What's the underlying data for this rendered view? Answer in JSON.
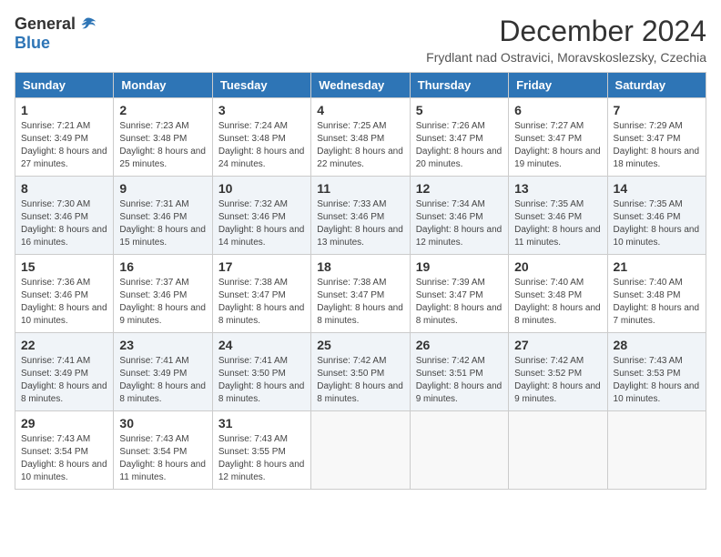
{
  "logo": {
    "general": "General",
    "blue": "Blue"
  },
  "title": "December 2024",
  "subtitle": "Frydlant nad Ostravici, Moravskoslezsky, Czechia",
  "days_of_week": [
    "Sunday",
    "Monday",
    "Tuesday",
    "Wednesday",
    "Thursday",
    "Friday",
    "Saturday"
  ],
  "weeks": [
    [
      {
        "day": "1",
        "info": "Sunrise: 7:21 AM\nSunset: 3:49 PM\nDaylight: 8 hours and 27 minutes."
      },
      {
        "day": "2",
        "info": "Sunrise: 7:23 AM\nSunset: 3:48 PM\nDaylight: 8 hours and 25 minutes."
      },
      {
        "day": "3",
        "info": "Sunrise: 7:24 AM\nSunset: 3:48 PM\nDaylight: 8 hours and 24 minutes."
      },
      {
        "day": "4",
        "info": "Sunrise: 7:25 AM\nSunset: 3:48 PM\nDaylight: 8 hours and 22 minutes."
      },
      {
        "day": "5",
        "info": "Sunrise: 7:26 AM\nSunset: 3:47 PM\nDaylight: 8 hours and 20 minutes."
      },
      {
        "day": "6",
        "info": "Sunrise: 7:27 AM\nSunset: 3:47 PM\nDaylight: 8 hours and 19 minutes."
      },
      {
        "day": "7",
        "info": "Sunrise: 7:29 AM\nSunset: 3:47 PM\nDaylight: 8 hours and 18 minutes."
      }
    ],
    [
      {
        "day": "8",
        "info": "Sunrise: 7:30 AM\nSunset: 3:46 PM\nDaylight: 8 hours and 16 minutes."
      },
      {
        "day": "9",
        "info": "Sunrise: 7:31 AM\nSunset: 3:46 PM\nDaylight: 8 hours and 15 minutes."
      },
      {
        "day": "10",
        "info": "Sunrise: 7:32 AM\nSunset: 3:46 PM\nDaylight: 8 hours and 14 minutes."
      },
      {
        "day": "11",
        "info": "Sunrise: 7:33 AM\nSunset: 3:46 PM\nDaylight: 8 hours and 13 minutes."
      },
      {
        "day": "12",
        "info": "Sunrise: 7:34 AM\nSunset: 3:46 PM\nDaylight: 8 hours and 12 minutes."
      },
      {
        "day": "13",
        "info": "Sunrise: 7:35 AM\nSunset: 3:46 PM\nDaylight: 8 hours and 11 minutes."
      },
      {
        "day": "14",
        "info": "Sunrise: 7:35 AM\nSunset: 3:46 PM\nDaylight: 8 hours and 10 minutes."
      }
    ],
    [
      {
        "day": "15",
        "info": "Sunrise: 7:36 AM\nSunset: 3:46 PM\nDaylight: 8 hours and 10 minutes."
      },
      {
        "day": "16",
        "info": "Sunrise: 7:37 AM\nSunset: 3:46 PM\nDaylight: 8 hours and 9 minutes."
      },
      {
        "day": "17",
        "info": "Sunrise: 7:38 AM\nSunset: 3:47 PM\nDaylight: 8 hours and 8 minutes."
      },
      {
        "day": "18",
        "info": "Sunrise: 7:38 AM\nSunset: 3:47 PM\nDaylight: 8 hours and 8 minutes."
      },
      {
        "day": "19",
        "info": "Sunrise: 7:39 AM\nSunset: 3:47 PM\nDaylight: 8 hours and 8 minutes."
      },
      {
        "day": "20",
        "info": "Sunrise: 7:40 AM\nSunset: 3:48 PM\nDaylight: 8 hours and 8 minutes."
      },
      {
        "day": "21",
        "info": "Sunrise: 7:40 AM\nSunset: 3:48 PM\nDaylight: 8 hours and 7 minutes."
      }
    ],
    [
      {
        "day": "22",
        "info": "Sunrise: 7:41 AM\nSunset: 3:49 PM\nDaylight: 8 hours and 8 minutes."
      },
      {
        "day": "23",
        "info": "Sunrise: 7:41 AM\nSunset: 3:49 PM\nDaylight: 8 hours and 8 minutes."
      },
      {
        "day": "24",
        "info": "Sunrise: 7:41 AM\nSunset: 3:50 PM\nDaylight: 8 hours and 8 minutes."
      },
      {
        "day": "25",
        "info": "Sunrise: 7:42 AM\nSunset: 3:50 PM\nDaylight: 8 hours and 8 minutes."
      },
      {
        "day": "26",
        "info": "Sunrise: 7:42 AM\nSunset: 3:51 PM\nDaylight: 8 hours and 9 minutes."
      },
      {
        "day": "27",
        "info": "Sunrise: 7:42 AM\nSunset: 3:52 PM\nDaylight: 8 hours and 9 minutes."
      },
      {
        "day": "28",
        "info": "Sunrise: 7:43 AM\nSunset: 3:53 PM\nDaylight: 8 hours and 10 minutes."
      }
    ],
    [
      {
        "day": "29",
        "info": "Sunrise: 7:43 AM\nSunset: 3:54 PM\nDaylight: 8 hours and 10 minutes."
      },
      {
        "day": "30",
        "info": "Sunrise: 7:43 AM\nSunset: 3:54 PM\nDaylight: 8 hours and 11 minutes."
      },
      {
        "day": "31",
        "info": "Sunrise: 7:43 AM\nSunset: 3:55 PM\nDaylight: 8 hours and 12 minutes."
      },
      null,
      null,
      null,
      null
    ]
  ]
}
